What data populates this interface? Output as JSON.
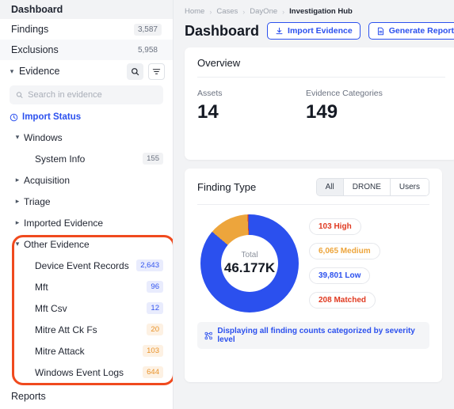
{
  "sidebar": {
    "top_item": {
      "label": "Dashboard"
    },
    "nav_items": [
      {
        "label": "Findings",
        "count": "3,587"
      },
      {
        "label": "Exclusions",
        "count": "5,958"
      }
    ],
    "evidence_section": {
      "label": "Evidence",
      "search": {
        "placeholder": "Search in evidence",
        "value": ""
      },
      "import_status": {
        "label": "Import Status"
      },
      "groups": [
        {
          "label": "Windows",
          "expanded": true
        },
        {
          "label": "Acquisition",
          "expanded": false
        },
        {
          "label": "Triage",
          "expanded": false
        },
        {
          "label": "Imported Evidence",
          "expanded": false
        },
        {
          "label": "Other Evidence",
          "expanded": true
        }
      ],
      "windows_children": [
        {
          "label": "System Info",
          "count": "155",
          "tone": "grey"
        }
      ],
      "other_evidence_children": [
        {
          "label": "Device Event Records",
          "count": "2,643",
          "tone": "blue"
        },
        {
          "label": "Mft",
          "count": "96",
          "tone": "blue"
        },
        {
          "label": "Mft Csv",
          "count": "12",
          "tone": "blue"
        },
        {
          "label": "Mitre Att Ck Fs",
          "count": "20",
          "tone": "orange"
        },
        {
          "label": "Mitre Attack",
          "count": "103",
          "tone": "orange"
        },
        {
          "label": "Windows Event Logs",
          "count": "644",
          "tone": "orange"
        }
      ]
    },
    "reports_item": {
      "label": "Reports"
    },
    "annotation": {
      "color": "#f04a1e"
    }
  },
  "header": {
    "breadcrumb": [
      "Home",
      "Cases",
      "DayOne",
      "Investigation Hub"
    ],
    "separator": "›",
    "title": "Dashboard",
    "buttons": [
      {
        "label": "Import Evidence",
        "icon": "import-icon"
      },
      {
        "label": "Generate Report",
        "icon": "document-icon"
      },
      {
        "label": "",
        "icon": "upload-icon"
      }
    ]
  },
  "overview": {
    "title": "Overview",
    "stats": [
      {
        "label": "Assets",
        "value": "14"
      },
      {
        "label": "Evidence Categories",
        "value": "149"
      }
    ]
  },
  "finding_type": {
    "title": "Finding Type",
    "tabs": [
      {
        "label": "All",
        "active": true
      },
      {
        "label": "DRONE",
        "active": false
      },
      {
        "label": "Users",
        "active": false
      }
    ],
    "donut": {
      "center_label": "Total",
      "center_value": "46.177K"
    },
    "legend": [
      {
        "label": "103 High",
        "color": "#e03a21"
      },
      {
        "label": "6,065 Medium",
        "color": "#eda53c"
      },
      {
        "label": "39,801 Low",
        "color": "#2b50ee"
      },
      {
        "label": "208 Matched",
        "color": "#e03a21"
      }
    ],
    "note": {
      "icon": "network-icon",
      "text": "Displaying all finding counts categorized by severity level"
    }
  },
  "chart_data": {
    "type": "pie",
    "title": "Finding Type",
    "categories": [
      "High",
      "Medium",
      "Low",
      "Matched"
    ],
    "values": [
      103,
      6065,
      39801,
      208
    ],
    "colors": [
      "#e03a21",
      "#eda53c",
      "#2b50ee",
      "#e03a21"
    ],
    "total_label": "Total",
    "total_value": "46.177K",
    "legend_position": "right",
    "donut": true
  },
  "theme": {
    "accent": "#2b50ee",
    "annotation": "#f04a1e",
    "canvas": "#f2f3f5"
  }
}
